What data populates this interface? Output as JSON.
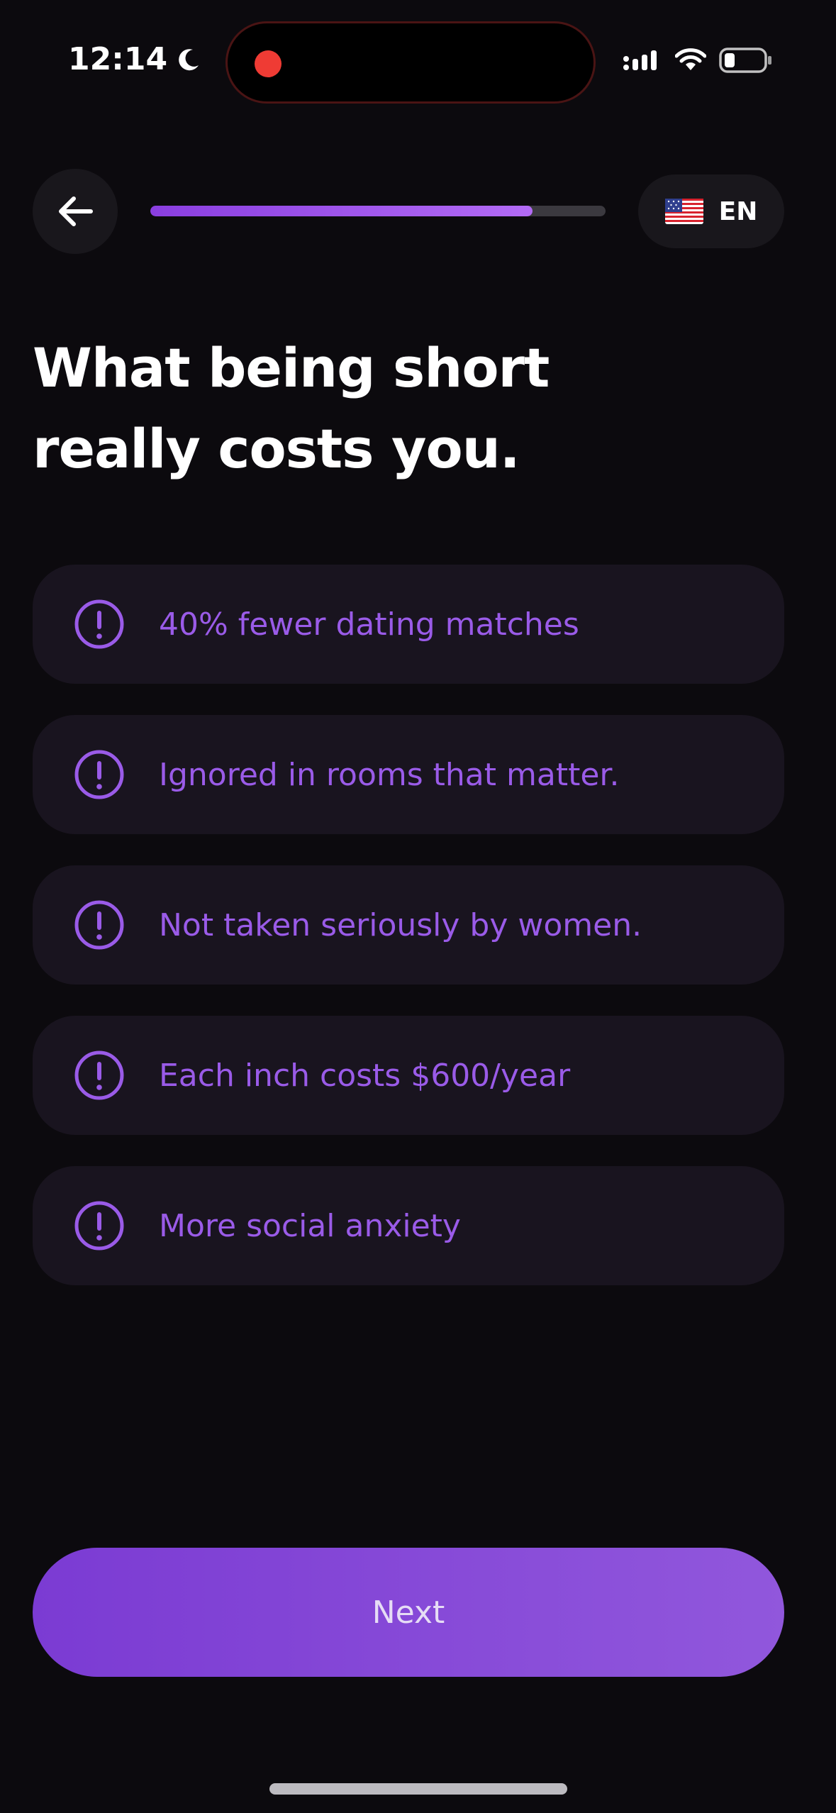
{
  "status_bar": {
    "time": "12:14",
    "icons": [
      "moon-icon",
      "recording-dot-icon",
      "cellular-signal-icon",
      "wifi-icon",
      "battery-icon"
    ]
  },
  "header": {
    "back_icon": "arrow-left-icon",
    "progress_fraction": 0.84,
    "progress_colors": [
      "#8a3ee0",
      "#b36bf5"
    ],
    "language": {
      "flag_icon": "us-flag-icon",
      "code": "EN"
    }
  },
  "title": {
    "line1": "What being short",
    "line2": "really costs you."
  },
  "costs": {
    "icon": "exclamation-circle-icon",
    "accent_color": "#9a5be8",
    "items": [
      {
        "label": "40% fewer dating matches"
      },
      {
        "label": "Ignored in rooms that matter."
      },
      {
        "label": "Not taken seriously by women."
      },
      {
        "label": "Each inch costs $600/year"
      },
      {
        "label": "More social anxiety"
      }
    ]
  },
  "next_button": {
    "label": "Next",
    "gradient": [
      "#7b3bd3",
      "#9157dc"
    ]
  }
}
